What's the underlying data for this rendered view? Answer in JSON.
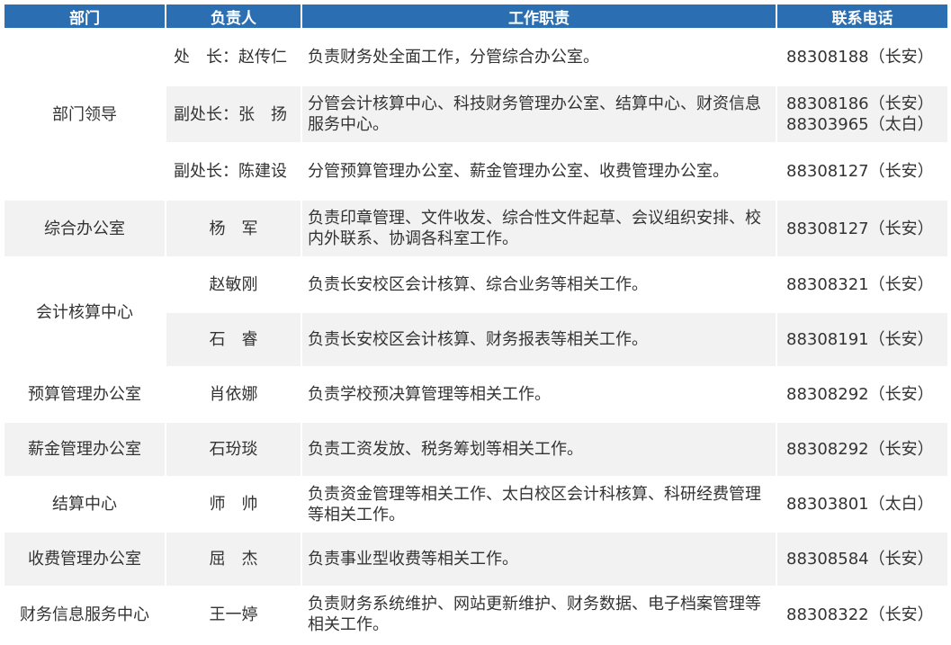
{
  "headers": {
    "dept": "部门",
    "person": "负责人",
    "duty": "工作职责",
    "phone": "联系电话"
  },
  "rows": [
    {
      "dept": "部门领导",
      "person": "处　长：赵传仁",
      "duty": "负责财务处全面工作，分管综合办公室。",
      "phones": [
        "88308188（长安）"
      ]
    },
    {
      "person": "副处长：张　扬",
      "duty": "分管会计核算中心、科技财务管理办公室、结算中心、财资信息服务中心。",
      "phones": [
        "88308186（长安）",
        "88303965（太白）"
      ]
    },
    {
      "person": "副处长：陈建设",
      "duty": "分管预算管理办公室、薪金管理办公室、收费管理办公室。",
      "phones": [
        "88308127（长安）"
      ]
    },
    {
      "dept": "综合办公室",
      "person": "杨　军",
      "duty": "负责印章管理、文件收发、综合性文件起草、会议组织安排、校内外联系、协调各科室工作。",
      "phones": [
        "88308127（长安）"
      ]
    },
    {
      "dept": "会计核算中心",
      "person": "赵敏刚",
      "duty": "负责长安校区会计核算、综合业务等相关工作。",
      "phones": [
        "88308321（长安）"
      ]
    },
    {
      "person": "石　睿",
      "duty": "负责长安校区会计核算、财务报表等相关工作。",
      "phones": [
        "88308191（长安）"
      ]
    },
    {
      "dept": "预算管理办公室",
      "person": "肖依娜",
      "duty": "负责学校预决算管理等相关工作。",
      "phones": [
        "88308292（长安）"
      ]
    },
    {
      "dept": "薪金管理办公室",
      "person": "石玢琰",
      "duty": "负责工资发放、税务筹划等相关工作。",
      "phones": [
        "88308292（长安）"
      ]
    },
    {
      "dept": "结算中心",
      "person": "师　帅",
      "duty": "负责资金管理等相关工作、太白校区会计科核算、科研经费管理等相关工作。",
      "phones": [
        "88303801（太白）"
      ]
    },
    {
      "dept": "收费管理办公室",
      "person": "屈　杰",
      "duty": "负责事业型收费等相关工作。",
      "phones": [
        "88308584（长安）"
      ]
    },
    {
      "dept": "财务信息服务中心",
      "person": "王一婷",
      "duty": "负责财务系统维护、网站更新维护、财务数据、电子档案管理等相关工作。",
      "phones": [
        "88308322（长安）"
      ]
    }
  ]
}
